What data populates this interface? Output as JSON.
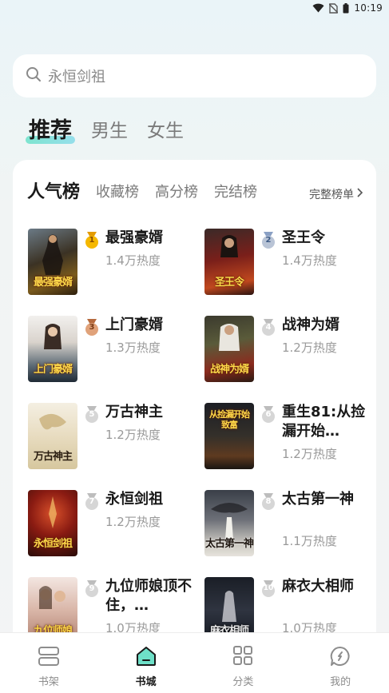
{
  "status_bar": {
    "time": "10:19"
  },
  "search": {
    "placeholder": "永恒剑祖"
  },
  "top_tabs": [
    "推荐",
    "男生",
    "女生"
  ],
  "rank_tabs": [
    "人气榜",
    "收藏榜",
    "高分榜",
    "完结榜"
  ],
  "full_list_label": "完整榜单",
  "books": [
    {
      "rank": "1",
      "title": "最强豪婿",
      "heat": "1.4万热度",
      "cover_text": "最强豪婿"
    },
    {
      "rank": "2",
      "title": "圣王令",
      "heat": "1.4万热度",
      "cover_text": "圣王令"
    },
    {
      "rank": "3",
      "title": "上门豪婿",
      "heat": "1.3万热度",
      "cover_text": "上门豪婿"
    },
    {
      "rank": "4",
      "title": "战神为婿",
      "heat": "1.2万热度",
      "cover_text": "战神为婿"
    },
    {
      "rank": "5",
      "title": "万古神主",
      "heat": "1.2万热度",
      "cover_text": "万古神主"
    },
    {
      "rank": "6",
      "title": "重生81:从捡漏开始…",
      "heat": "1.2万热度",
      "cover_text": "从捡漏开始致富"
    },
    {
      "rank": "7",
      "title": "永恒剑祖",
      "heat": "1.2万热度",
      "cover_text": "永恒剑祖"
    },
    {
      "rank": "8",
      "title": "太古第一神",
      "heat": "1.1万热度",
      "cover_text": "太古第一神"
    },
    {
      "rank": "9",
      "title": "九位师娘顶不住，…",
      "heat": "1.0万热度",
      "cover_text": "九位师娘"
    },
    {
      "rank": "10",
      "title": "麻衣大相师",
      "heat": "1.0万热度",
      "cover_text": "麻衣相师"
    }
  ],
  "bottom_nav": [
    "书架",
    "书城",
    "分类",
    "我的"
  ],
  "colors": {
    "gold": "#f5b800",
    "silver": "#b9c4d6",
    "bronze": "#d08a5c",
    "grey_badge": "#c8c8c8",
    "accent_mint": "#62e0c6"
  }
}
